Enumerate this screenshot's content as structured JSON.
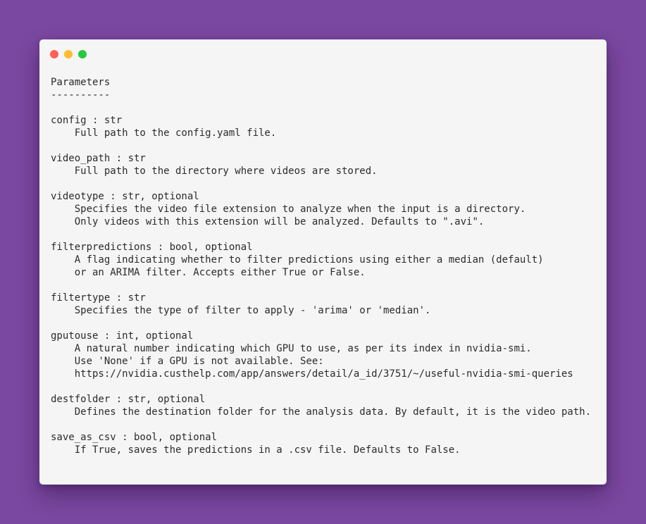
{
  "window": {
    "controls": {
      "close": "close",
      "minimize": "minimize",
      "zoom": "zoom"
    },
    "colors": {
      "background": "#7a48a0",
      "window": "#f5f5f5",
      "close": "#ff5f56",
      "minimize": "#ffbd2e",
      "zoom": "#27c93f",
      "text": "#2b2b2b"
    }
  },
  "code": {
    "lines": [
      "Parameters",
      "----------",
      "",
      "config : str",
      "    Full path to the config.yaml file.",
      "",
      "video_path : str",
      "    Full path to the directory where videos are stored.",
      "",
      "videotype : str, optional",
      "    Specifies the video file extension to analyze when the input is a directory.",
      "    Only videos with this extension will be analyzed. Defaults to \".avi\".",
      "",
      "filterpredictions : bool, optional",
      "    A flag indicating whether to filter predictions using either a median (default)",
      "    or an ARIMA filter. Accepts either True or False.",
      "",
      "filtertype : str",
      "    Specifies the type of filter to apply - 'arima' or 'median'.",
      "",
      "gputouse : int, optional",
      "    A natural number indicating which GPU to use, as per its index in nvidia-smi.",
      "    Use 'None' if a GPU is not available. See:",
      "    https://nvidia.custhelp.com/app/answers/detail/a_id/3751/~/useful-nvidia-smi-queries",
      "",
      "destfolder : str, optional",
      "    Defines the destination folder for the analysis data. By default, it is the video path.",
      "",
      "save_as_csv : bool, optional",
      "    If True, saves the predictions in a .csv file. Defaults to False."
    ]
  }
}
